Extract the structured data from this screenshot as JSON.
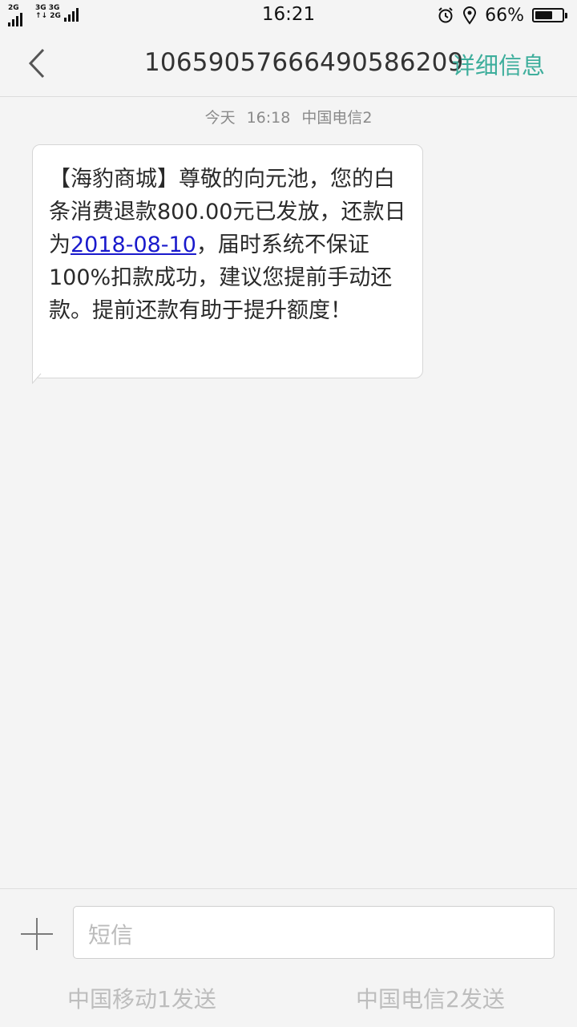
{
  "status_bar": {
    "sim1_type": "2G",
    "sim2_type_top": "3G 3G",
    "sim2_type_bottom": "↑↓ 2G",
    "time": "16:21",
    "battery_percent": "66%",
    "battery_level": 0.66,
    "icons": [
      "alarm-icon",
      "location-icon",
      "battery-icon"
    ]
  },
  "header": {
    "back_icon": "chevron-left-icon",
    "phone_number": "10659057666490586209",
    "detail_label": "详细信息"
  },
  "conversation": {
    "timestamp_day": "今天",
    "timestamp_time": "16:18",
    "timestamp_sim": "中国电信2",
    "message": {
      "part1": "【海豹商城】尊敬的向元池，您的白条消费退款800.00元已发放，还款日为",
      "link": "2018-08-10",
      "part2": "，届时系统不保证100%扣款成功，建议您提前手动还款。提前还款有助于提升额度！"
    }
  },
  "composer": {
    "attach_icon": "plus-icon",
    "placeholder": "短信",
    "send_sim1_label": "中国移动1发送",
    "send_sim2_label": "中国电信2发送"
  },
  "colors": {
    "accent": "#3eae9c",
    "link": "#1a1acc",
    "background": "#f4f4f4"
  }
}
